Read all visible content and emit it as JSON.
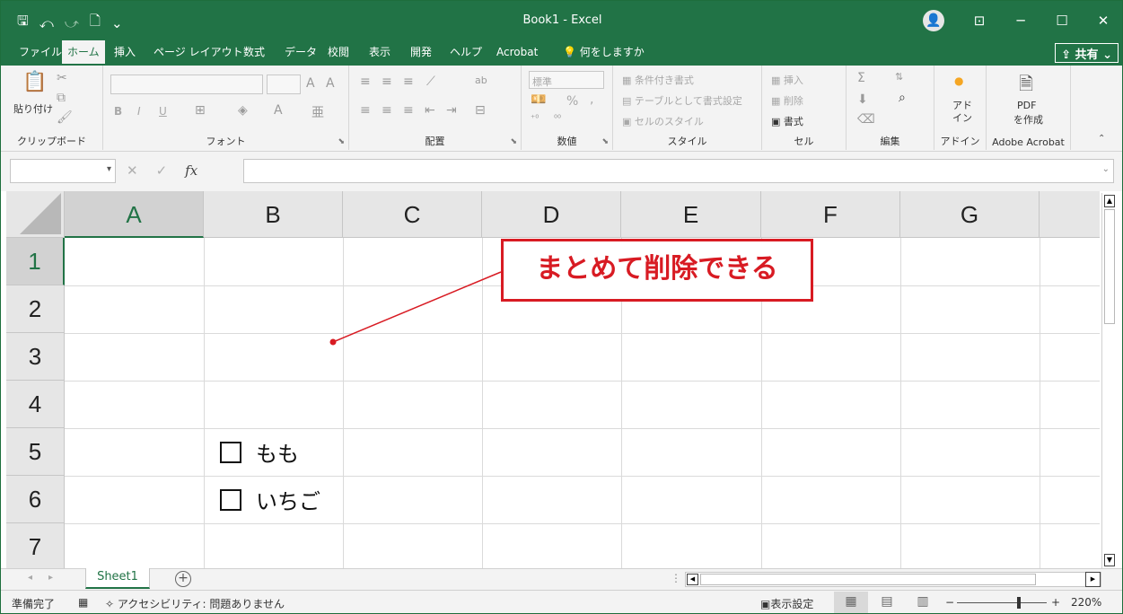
{
  "window": {
    "title": "Book1  -  Excel",
    "qat": {
      "save_icon": "save-icon",
      "undo": "⤺",
      "redo": "⤻",
      "new": "🗋",
      "more": "⌄"
    },
    "controls": {
      "ribbon_display": "⊡",
      "minimize": "─",
      "maximize": "☐",
      "close": "✕"
    }
  },
  "tabs": [
    "ファイル",
    "ホーム",
    "挿入",
    "ページ レイアウト",
    "数式",
    "データ",
    "校閲",
    "表示",
    "開発",
    "ヘルプ",
    "Acrobat",
    "何をしますか"
  ],
  "active_tab": "ホーム",
  "share_label": "共有",
  "ribbon": {
    "clipboard": {
      "paste": "貼り付け",
      "label": "クリップボード"
    },
    "font": {
      "bold": "B",
      "italic": "I",
      "underline": "U",
      "label": "フォント"
    },
    "alignment": {
      "label": "配置"
    },
    "number": {
      "format": "標準",
      "percent": "%",
      "comma": ",",
      "label": "数値"
    },
    "styles": {
      "conditional": "条件付き書式",
      "table": "テーブルとして書式設定",
      "cell": "セルのスタイル",
      "label": "スタイル"
    },
    "cells": {
      "insert": "挿入",
      "delete": "削除",
      "format": "書式",
      "label": "セル"
    },
    "editing": {
      "label": "編集"
    },
    "addins": {
      "addin": "アド\nイン",
      "label": "アドイン"
    },
    "acrobat": {
      "create_pdf_1": "PDF",
      "create_pdf_2": "を作成",
      "label": "Adobe Acrobat"
    }
  },
  "formula_bar": {
    "name_box": "",
    "fx": "fx",
    "cancel": "✕",
    "enter": "✓",
    "content": ""
  },
  "columns": [
    "A",
    "B",
    "C",
    "D",
    "E",
    "F",
    "G"
  ],
  "rows": [
    "1",
    "2",
    "3",
    "4",
    "5",
    "6",
    "7"
  ],
  "selected_column": "A",
  "selected_row": "1",
  "checkboxes": [
    {
      "label": "もも",
      "checked": false
    },
    {
      "label": "いちご",
      "checked": false
    }
  ],
  "callout": {
    "text": "まとめて削除できる",
    "color": "#d81b23"
  },
  "sheet_tabs": [
    "Sheet1"
  ],
  "status": {
    "ready": "準備完了",
    "accessibility": "アクセシビリティ: 問題ありません",
    "display_settings": "表示設定",
    "zoom": "220%"
  },
  "colors": {
    "excel_green": "#217346",
    "ribbon_bg": "#f3f3f3",
    "gridline": "#dadada"
  }
}
